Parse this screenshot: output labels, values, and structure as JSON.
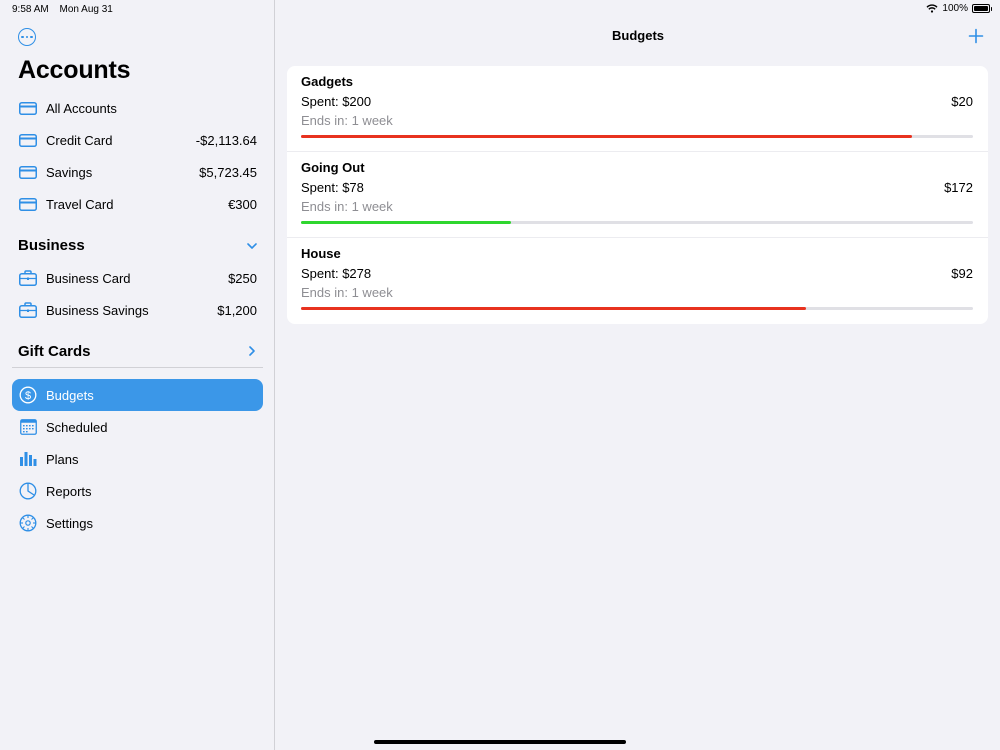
{
  "status": {
    "time": "9:58 AM",
    "date": "Mon Aug 31",
    "battery": "100%"
  },
  "sidebar": {
    "title": "Accounts",
    "accounts": [
      {
        "label": "All Accounts",
        "amount": "",
        "icon": "card-icon"
      },
      {
        "label": "Credit Card",
        "amount": "-$2,113.64",
        "icon": "card-icon"
      },
      {
        "label": "Savings",
        "amount": "$5,723.45",
        "icon": "card-icon"
      },
      {
        "label": "Travel Card",
        "amount": "€300",
        "icon": "card-icon"
      }
    ],
    "business": {
      "title": "Business",
      "items": [
        {
          "label": "Business Card",
          "amount": "$250",
          "icon": "briefcase-icon"
        },
        {
          "label": "Business Savings",
          "amount": "$1,200",
          "icon": "briefcase-icon"
        }
      ]
    },
    "gift_cards": {
      "title": "Gift Cards"
    },
    "nav": [
      {
        "label": "Budgets",
        "icon": "dollar-circle-icon",
        "selected": true
      },
      {
        "label": "Scheduled",
        "icon": "calendar-icon"
      },
      {
        "label": "Plans",
        "icon": "bar-chart-icon"
      },
      {
        "label": "Reports",
        "icon": "pie-chart-icon"
      },
      {
        "label": "Settings",
        "icon": "gear-icon"
      }
    ]
  },
  "main": {
    "title": "Budgets",
    "budgets": [
      {
        "name": "Gadgets",
        "spent": "Spent: $200",
        "remaining": "$20",
        "ends": "Ends in: 1 week",
        "progress": 0.909,
        "color": "#e8321f"
      },
      {
        "name": "Going Out",
        "spent": "Spent: $78",
        "remaining": "$172",
        "ends": "Ends in: 1 week",
        "progress": 0.312,
        "color": "#2fd62f"
      },
      {
        "name": "House",
        "spent": "Spent: $278",
        "remaining": "$92",
        "ends": "Ends in: 1 week",
        "progress": 0.751,
        "color": "#e8321f"
      }
    ]
  },
  "colors": {
    "accent": "#2f8fe6",
    "selected_bg": "#3b97e8"
  }
}
